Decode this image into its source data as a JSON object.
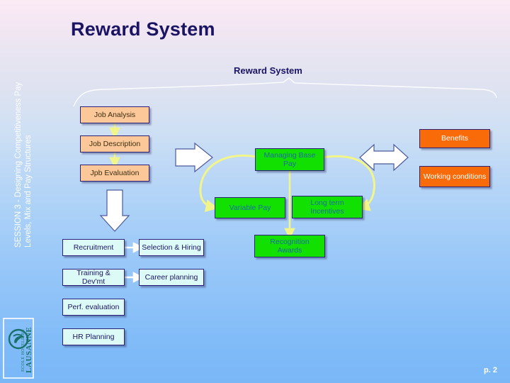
{
  "slide": {
    "main_title": "Reward System",
    "sub_title": "Reward System",
    "page_number": "p. 2",
    "session_label": "SESSION 3 - Designing Competitiveness Pay\nLevels, Mix and Pay Structures",
    "logo_line1": "ECOLE HOTELIERE",
    "logo_line2": "LAUSANNE"
  },
  "colors": {
    "peach": "#fcc89a",
    "green": "#11e000",
    "orange": "#f96a08",
    "mint": "#dcfbf7",
    "border": "#2b2178",
    "title": "#1b1464",
    "connector_yellow": "#f2f58a",
    "arrow_white": "#ffffff"
  },
  "boxes": {
    "job_analysis": "Job Analysis",
    "job_description": "Job Description",
    "job_evaluation": "Jpb Evaluation",
    "managing_base_pay": "Managing Base Pay",
    "variable_pay": "Variable Pay",
    "long_term_incentives": "Long term Incentives",
    "recognition_awards": "Recognition Awards",
    "benefits": "Benefits",
    "working_conditions": "Working conditions",
    "recruitment": "Recruitment",
    "selection_hiring": "Selection & Hiring",
    "training_devmt": "Training & Dev'mt",
    "career_planning": "Career planning",
    "perf_evaluation": "Perf. evaluation",
    "hr_planning": "HR Planning"
  },
  "icons": {
    "arrow_right": "right-arrow-icon",
    "arrow_down": "down-arrow-icon",
    "arrow_double": "double-headed-arrow-icon",
    "swoosh": "decorative-swoosh-icon",
    "logo": "ehl-logo-icon"
  }
}
